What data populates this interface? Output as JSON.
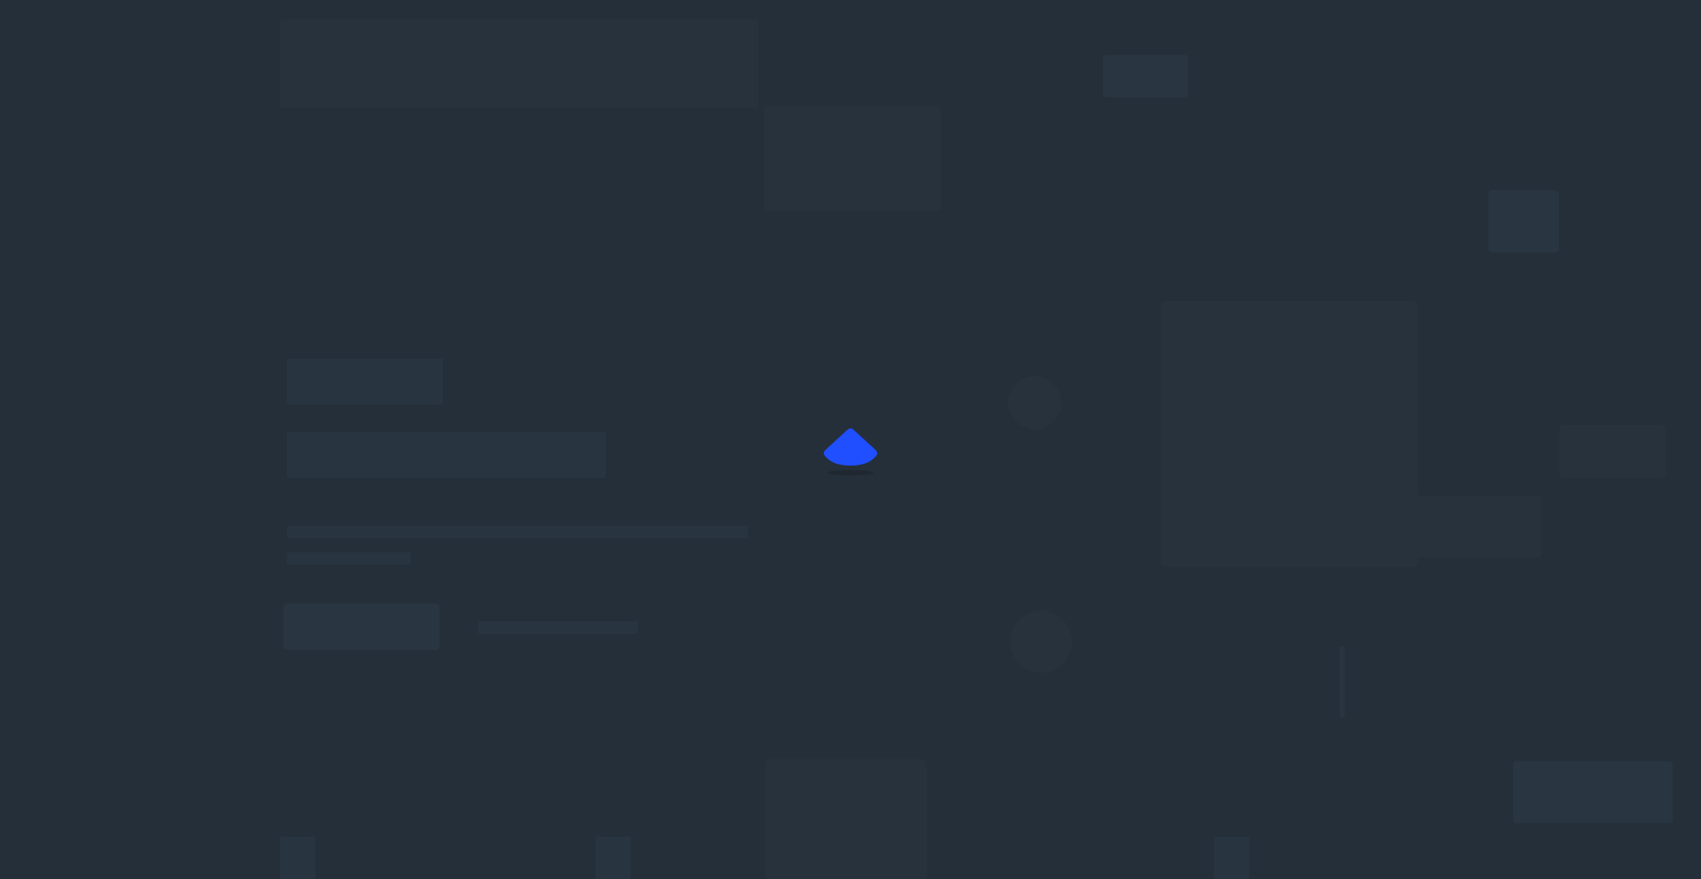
{
  "loader": {
    "icon": "loading-spinner-icon",
    "accent_color": "#1f4fff",
    "overlay_color": "#252f3a"
  }
}
